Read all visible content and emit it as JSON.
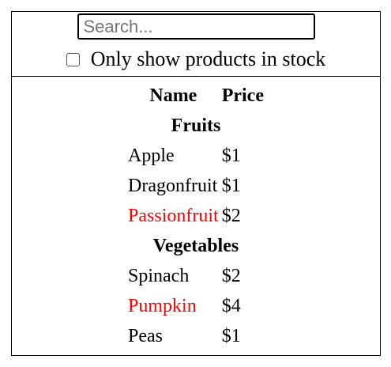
{
  "search": {
    "placeholder": "Search...",
    "value": ""
  },
  "stock_filter": {
    "label": "Only show products in stock",
    "checked": false
  },
  "table": {
    "headers": [
      "Name",
      "Price"
    ],
    "categories": [
      {
        "name": "Fruits",
        "products": [
          {
            "name": "Apple",
            "price": "$1",
            "in_stock": true
          },
          {
            "name": "Dragonfruit",
            "price": "$1",
            "in_stock": true
          },
          {
            "name": "Passionfruit",
            "price": "$2",
            "in_stock": false
          }
        ]
      },
      {
        "name": "Vegetables",
        "products": [
          {
            "name": "Spinach",
            "price": "$2",
            "in_stock": true
          },
          {
            "name": "Pumpkin",
            "price": "$4",
            "in_stock": false
          },
          {
            "name": "Peas",
            "price": "$1",
            "in_stock": true
          }
        ]
      }
    ]
  },
  "colors": {
    "out_of_stock": "#ff0000",
    "border": "#000000"
  }
}
